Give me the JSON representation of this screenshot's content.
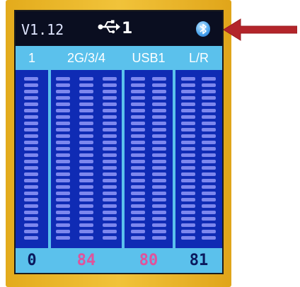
{
  "device": {
    "version": "V1.12",
    "usb_port": "1",
    "usb_icon": "usb-icon",
    "bluetooth_icon": "bluetooth-icon"
  },
  "channels": [
    {
      "label": "1",
      "level": "0",
      "level_color": "#0b1a5e",
      "bars": 1
    },
    {
      "label": "2G/3/4",
      "level": "84",
      "level_color": "#e0539b",
      "bars": 3
    },
    {
      "label": "USB1",
      "level": "80",
      "level_color": "#e0539b",
      "bars": 2
    },
    {
      "label": "L/R",
      "level": "81",
      "level_color": "#0b1a5e",
      "bars": 2
    }
  ],
  "colors": {
    "bezel": "#f1c33a",
    "header_bg": "#5bc1ec",
    "meter_bg": "#0f2bb4",
    "meter_segment": "#7d87ee",
    "annotation_arrow": "#b3252a"
  },
  "annotation": {
    "icon": "red-arrow-icon",
    "points_to": "bluetooth-icon"
  }
}
